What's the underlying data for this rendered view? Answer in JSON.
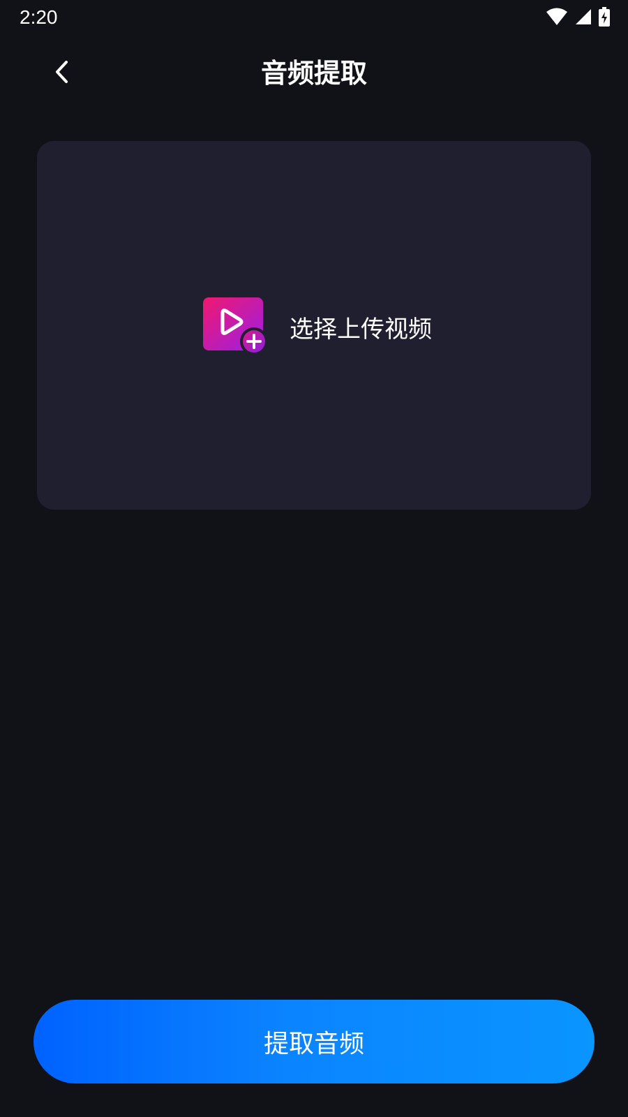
{
  "status_bar": {
    "time": "2:20",
    "icons": [
      "wifi-icon",
      "signal-icon",
      "battery-charging-icon"
    ]
  },
  "header": {
    "back_icon": "chevron-left-icon",
    "title": "音频提取"
  },
  "upload": {
    "icon": "video-add-icon",
    "label": "选择上传视频"
  },
  "actions": {
    "extract_label": "提取音频"
  },
  "colors": {
    "background": "#111217",
    "card": "#201f30",
    "button_gradient_start": "#0062ff",
    "button_gradient_end": "#0a95ff",
    "icon_gradient_start": "#f0196e",
    "icon_gradient_end": "#9b1ee6"
  }
}
